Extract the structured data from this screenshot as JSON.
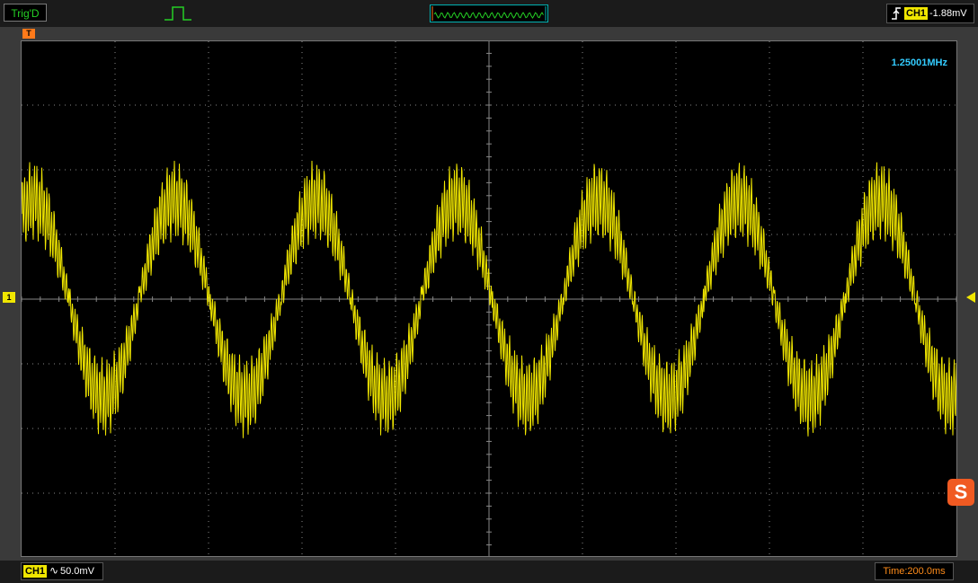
{
  "top": {
    "trigger_status": "Trig'D",
    "pulse_icon": "pulse-icon",
    "trigger_channel": "CH1",
    "trigger_level": "-1.88mV",
    "edge_icon": "rising-edge-icon"
  },
  "markers": {
    "trigger_position": "T",
    "channel": "1"
  },
  "screen": {
    "frequency": "1.25001MHz",
    "trace_color": "#f0e600",
    "grid_color": "#888888"
  },
  "bottom": {
    "channel": "CH1",
    "coupling": "∿",
    "volts_per_div": "50.0mV",
    "timebase": "Time:200.0ms"
  },
  "colors": {
    "trace": "#f0e600",
    "trigger_status": "#25d025",
    "frequency": "#33ccff",
    "timebase": "#ff8c1a",
    "trigger_marker": "#ff7a1a"
  },
  "logo": "S"
}
